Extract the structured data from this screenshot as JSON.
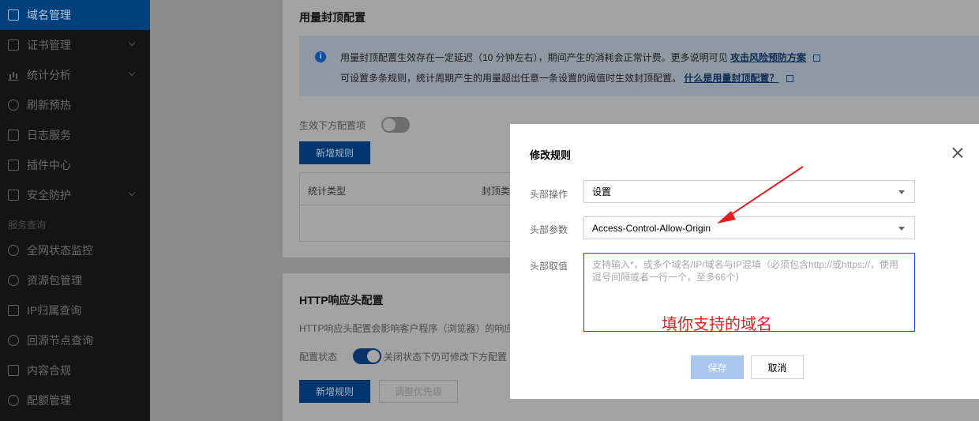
{
  "sidebar": {
    "items": [
      {
        "label": "域名管理",
        "icon": "domain-icon",
        "active": true
      },
      {
        "label": "证书管理",
        "icon": "certificate-icon",
        "chevron": true
      },
      {
        "label": "统计分析",
        "icon": "bar-chart-icon",
        "chevron": true
      },
      {
        "label": "刷新预热",
        "icon": "refresh-icon"
      },
      {
        "label": "日志服务",
        "icon": "log-icon"
      },
      {
        "label": "插件中心",
        "icon": "plugin-icon"
      },
      {
        "label": "安全防护",
        "icon": "shield-icon",
        "chevron": true
      }
    ],
    "section_label": "服务查询",
    "section_items": [
      {
        "label": "全网状态监控",
        "icon": "monitor-icon"
      },
      {
        "label": "资源包管理",
        "icon": "package-icon"
      },
      {
        "label": "IP归属查询",
        "icon": "ip-icon"
      },
      {
        "label": "回源节点查询",
        "icon": "search-node-icon"
      },
      {
        "label": "内容合规",
        "icon": "image-icon"
      },
      {
        "label": "配额管理",
        "icon": "quota-icon"
      }
    ]
  },
  "usage_panel": {
    "title": "用量封顶配置",
    "notice_line1": "用量封顶配置生效存在一定延迟（10 分钟左右），期间产生的消耗会正常计费。更多说明可见",
    "notice_link1": "攻击风险预防方案",
    "notice_line2": "可设置多条规则，统计周期产生的用量超出任意一条设置的阈值时生效封顶配置。",
    "notice_link2": "什么是用量封顶配置？",
    "toggle_label": "生效下方配置项",
    "add_rule_button": "新增规则",
    "table_headers": [
      "统计类型",
      "封顶类"
    ]
  },
  "http_panel": {
    "title": "HTTP响应头配置",
    "description": "HTTP响应头配置会影响客户程序（浏览器）的响应",
    "status_label": "配置状态",
    "status_hint": "关闭状态下仍可修改下方配置",
    "add_rule_button": "新增规则",
    "adjust_priority_button": "调整优先级"
  },
  "modal": {
    "title": "修改规则",
    "header_operation_label": "头部操作",
    "header_operation_value": "设置",
    "header_param_label": "头部参数",
    "header_param_value": "Access-Control-Allow-Origin",
    "header_value_label": "头部取值",
    "header_value_placeholder": "支持输入*，或多个域名/IP/域名与IP混填（必须包含http://或https://，使用逗号间隔或者一行一个，至多66个）",
    "annotation": "填你支持的域名",
    "save_button": "保存",
    "cancel_button": "取消"
  },
  "colors": {
    "accent": "#0052d9",
    "annotation_red": "#e02020",
    "sidebar_active": "#00417d"
  }
}
